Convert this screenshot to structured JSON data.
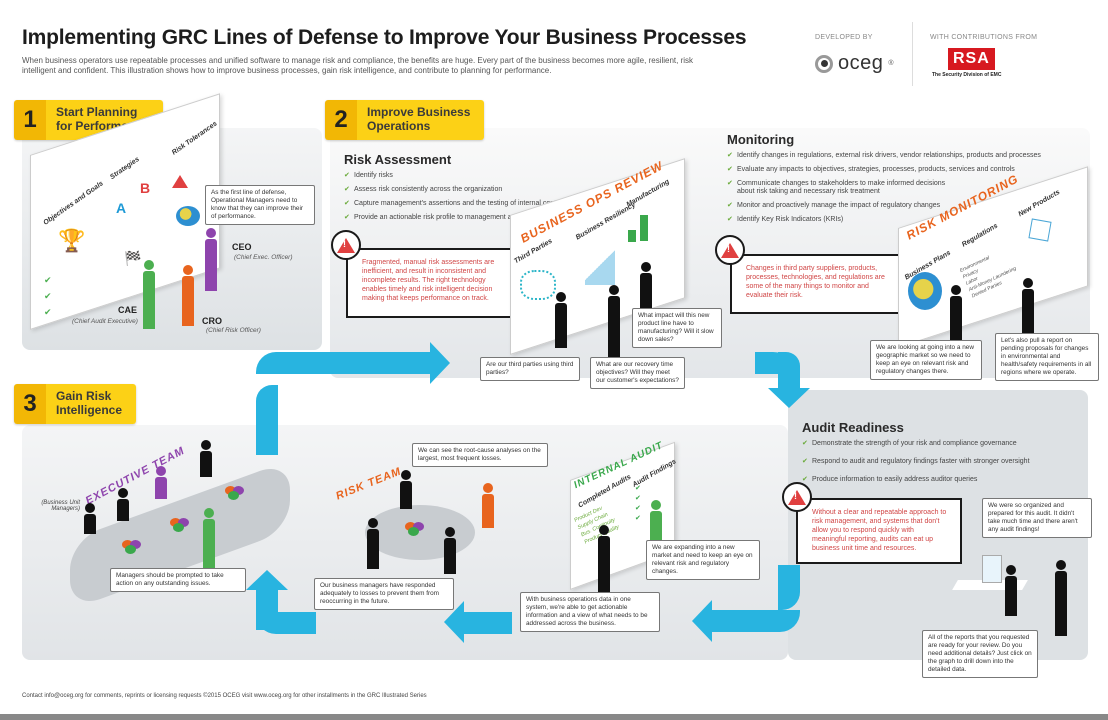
{
  "header": {
    "title": "Implementing GRC Lines of Defense to Improve Your Business Processes",
    "subtitle": "When business operators use repeatable processes and unified software to manage risk and compliance, the benefits are huge. Every part of the business becomes more agile, resilient, risk intelligent and confident. This illustration shows how to improve business processes, gain risk intelligence, and contribute to planning for performance.",
    "developed_by_label": "DEVELOPED BY",
    "developer_logo": "oceg",
    "developer_mark": "®",
    "contributions_label": "WITH CONTRIBUTIONS FROM",
    "contributor_logo": "RSA",
    "contributor_tagline": "The Security Division of EMC"
  },
  "colors": {
    "badge_yellow": "#fcd116",
    "badge_number": "#f2b705",
    "arrow_blue": "#28b4e0",
    "warning_red": "#e04040",
    "ceo_purple": "#8e44ad",
    "cae_green": "#4caf50",
    "cro_orange": "#e8641e",
    "check_green": "#6aaa3a"
  },
  "section1": {
    "number": "1",
    "title_line1": "Start Planning",
    "title_line2": "for Performance",
    "board_columns": [
      "Objectives and Goals",
      "Strategies",
      "Risk Tolerances"
    ],
    "strategy_letters": [
      "A",
      "B"
    ],
    "bubble": "As the first line of defense, Operational Managers need to know that they can improve their of performance.",
    "roles": [
      {
        "abbr": "CEO",
        "full": "(Chief Exec. Officer)"
      },
      {
        "abbr": "CAE",
        "full": "(Chief Audit Executive)"
      },
      {
        "abbr": "CRO",
        "full": "(Chief Risk Officer)"
      }
    ]
  },
  "section2": {
    "number": "2",
    "title_line1": "Improve Business",
    "title_line2": "Operations",
    "risk_assessment": {
      "title": "Risk Assessment",
      "items": [
        "Identify risks",
        "Assess risk consistently across the organization",
        "Capture management's assertions and the testing of internal controls",
        "Provide an actionable risk profile to management and the board"
      ],
      "warning": "Fragmented, manual risk assessments are inefficient, and result in inconsistent and incomplete results. The right technology enables timely and risk intelligent decision making that keeps performance on track."
    },
    "ops_review": {
      "title": "BUSINESS OPS REVIEW",
      "columns": [
        "Third Parties",
        "Business Resiliency",
        "Manufacturing"
      ],
      "bubbles": [
        "Are our third parties using third parties?",
        "What are our recovery time objectives? Will they meet our customer's expectations?",
        "What impact will this new product line have to manufacturing? Will it slow down sales?"
      ]
    },
    "monitoring": {
      "title": "Monitoring",
      "items": [
        "Identify changes in regulations, external risk drivers, vendor relationships, products and processes",
        "Evaluate any impacts to objectives, strategies, processes, products, services and controls",
        "Communicate changes to stakeholders to make informed decisions about risk taking and necessary risk treatment",
        "Monitor and proactively manage the impact of regulatory changes",
        "Identify Key Risk Indicators (KRIs)"
      ],
      "warning": "Changes in third party suppliers, products, processes, technologies, and regulations are some of the many things to monitor and evaluate their risk."
    },
    "risk_monitoring": {
      "title": "RISK MONITORING",
      "columns": [
        "Business Plans",
        "Regulations",
        "New Products"
      ],
      "regulation_items": [
        "Environmental",
        "Privacy",
        "Labor",
        "Anti-Money Laundering",
        "Denied Parties"
      ],
      "bubbles": [
        "We are looking at going into a new geographic market so we need to keep an eye on relevant risk and regulatory changes there.",
        "Let's also pull a report on pending proposals for changes in environmental and health/safety requirements in all regions where we operate."
      ]
    },
    "audit_readiness": {
      "title": "Audit Readiness",
      "items": [
        "Demonstrate the strength of your risk and compliance governance",
        "Respond to audit and regulatory findings faster with stronger oversight",
        "Produce information to easily address auditor queries"
      ],
      "warning": "Without a clear and repeatable approach to risk management, and systems that don't allow you to respond quickly with meaningful reporting, audits can eat up business unit time and resources.",
      "bubbles": [
        "We were so organized and prepared for this audit. It didn't take much time and there aren't any audit findings!",
        "All of the reports that you requested are ready for your review. Do you need additional details? Just click on the graph to drill down into the detailed data."
      ]
    }
  },
  "section3": {
    "number": "3",
    "title_line1": "Gain Risk",
    "title_line2": "Intelligence",
    "executive_team": {
      "title": "EXECUTIVE TEAM",
      "side_label": "(Business Unit Managers)",
      "bubble": "Managers should be prompted to take action on any outstanding issues."
    },
    "risk_team": {
      "title": "RISK TEAM",
      "bubbles": [
        "We can see the root-cause analyses on the largest, most frequent losses.",
        "Our business managers have responded adequately to losses to prevent them from reoccurring in the future."
      ]
    },
    "internal_audit": {
      "title": "INTERNAL AUDIT",
      "columns": [
        "Completed Audits",
        "Audit Findings"
      ],
      "completed_items": [
        "Product Dev",
        "Supply Chain",
        "Bus. Continuity",
        "Product Quality"
      ],
      "bubbles": [
        "We are expanding into a new market and need to keep an eye on relevant risk and regulatory changes.",
        "With business operations data in one system, we're able to get actionable information and a view of what needs to be addressed across the business."
      ]
    }
  },
  "footer": {
    "text": "Contact info@oceg.org for comments, reprints or licensing requests ©2015 OCEG visit www.oceg.org for other installments in the GRC Illustrated Series"
  }
}
